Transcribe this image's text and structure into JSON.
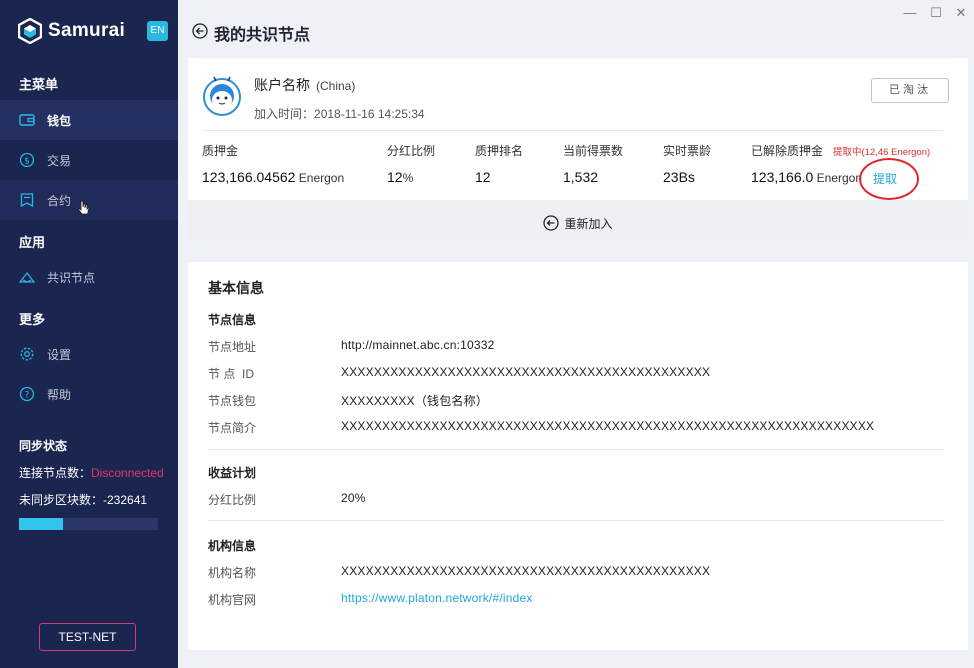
{
  "window": {
    "minimize": "—",
    "maximize": "☐",
    "close": "✕"
  },
  "sidebar": {
    "brand": "Samurai",
    "lang": "EN",
    "main_menu_title": "主菜单",
    "main_items": [
      {
        "label": "钱包",
        "icon": "wallet-icon"
      },
      {
        "label": "交易",
        "icon": "transaction-icon"
      },
      {
        "label": "合约",
        "icon": "contract-icon"
      }
    ],
    "apps_title": "应用",
    "app_items": [
      {
        "label": "共识节点",
        "icon": "consensus-node-icon"
      }
    ],
    "more_title": "更多",
    "more_items": [
      {
        "label": "设置",
        "icon": "gear-icon"
      },
      {
        "label": "帮助",
        "icon": "help-icon"
      }
    ],
    "sync": {
      "title": "同步状态",
      "nodes_label": "连接节点数：",
      "nodes_value": "Disconnected",
      "blocks_label": "未同步区块数：",
      "blocks_value": "-232641",
      "progress": 0.32
    },
    "network": "TEST-NET"
  },
  "header": {
    "title": "我的共识节点"
  },
  "account": {
    "name": "账户名称",
    "region": "(China)",
    "join_label": "加入时间：",
    "join_time": "2018-11-16 14:25:34",
    "status": "已淘汰"
  },
  "stats": [
    {
      "label": "质押金",
      "value": "123,166.04562",
      "unit": " Energon"
    },
    {
      "label": "分红比例",
      "value": "12",
      "unit": "%"
    },
    {
      "label": "质押排名",
      "value": "12",
      "unit": ""
    },
    {
      "label": "当前得票数",
      "value": "1,532",
      "unit": ""
    },
    {
      "label": "实时票龄",
      "value": "23Bs",
      "unit": ""
    },
    {
      "label": "已解除质押金",
      "value": "123,166.0",
      "unit": " Energon"
    }
  ],
  "withdraw": {
    "pending": "提取中(12,46 Energon)",
    "action": "提取"
  },
  "rejoin": "重新加入",
  "details": {
    "title": "基本信息",
    "node_info": {
      "title": "节点信息",
      "rows": [
        {
          "label": "节点地址",
          "value": "http://mainnet.abc.cn:10332"
        },
        {
          "label": "节 点  ID",
          "value": "XXXXXXXXXXXXXXXXXXXXXXXXXXXXXXXXXXXXXXXXXXXXX"
        },
        {
          "label": "节点钱包",
          "value": "XXXXXXXXX（钱包名称）"
        },
        {
          "label": "节点简介",
          "value": "XXXXXXXXXXXXXXXXXXXXXXXXXXXXXXXXXXXXXXXXXXXXXXXXXXXXXXXXXXXXXXXXX"
        }
      ]
    },
    "revenue": {
      "title": "收益计划",
      "rows": [
        {
          "label": "分红比例",
          "value": "20%"
        }
      ]
    },
    "org": {
      "title": "机构信息",
      "rows": [
        {
          "label": "机构名称",
          "value": "XXXXXXXXXXXXXXXXXXXXXXXXXXXXXXXXXXXXXXXXXXXXX"
        },
        {
          "label": "机构官网",
          "value": "https://www.platon.network/#/index"
        }
      ]
    }
  },
  "colors": {
    "sidebar_bg": "#1a2550",
    "accent": "#29b8e0",
    "danger": "#e02f2f",
    "link": "#1fa5df"
  }
}
